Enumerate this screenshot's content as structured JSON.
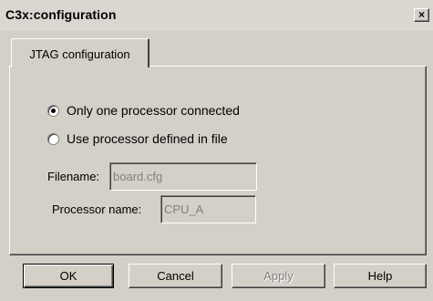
{
  "window": {
    "title": "C3x:configuration",
    "close_glyph": "×"
  },
  "tabs": [
    {
      "label": "JTAG configuration",
      "selected": true
    }
  ],
  "options": {
    "only_one_label": "Only one processor connected",
    "only_one_selected": true,
    "use_file_label": "Use processor defined in file",
    "use_file_selected": false
  },
  "fields": {
    "filename_label": "Filename:",
    "filename_value": "board.cfg",
    "processor_label": "Processor name:",
    "processor_value": "CPU_A"
  },
  "buttons": {
    "ok": "OK",
    "cancel": "Cancel",
    "apply": "Apply",
    "help": "Help"
  }
}
